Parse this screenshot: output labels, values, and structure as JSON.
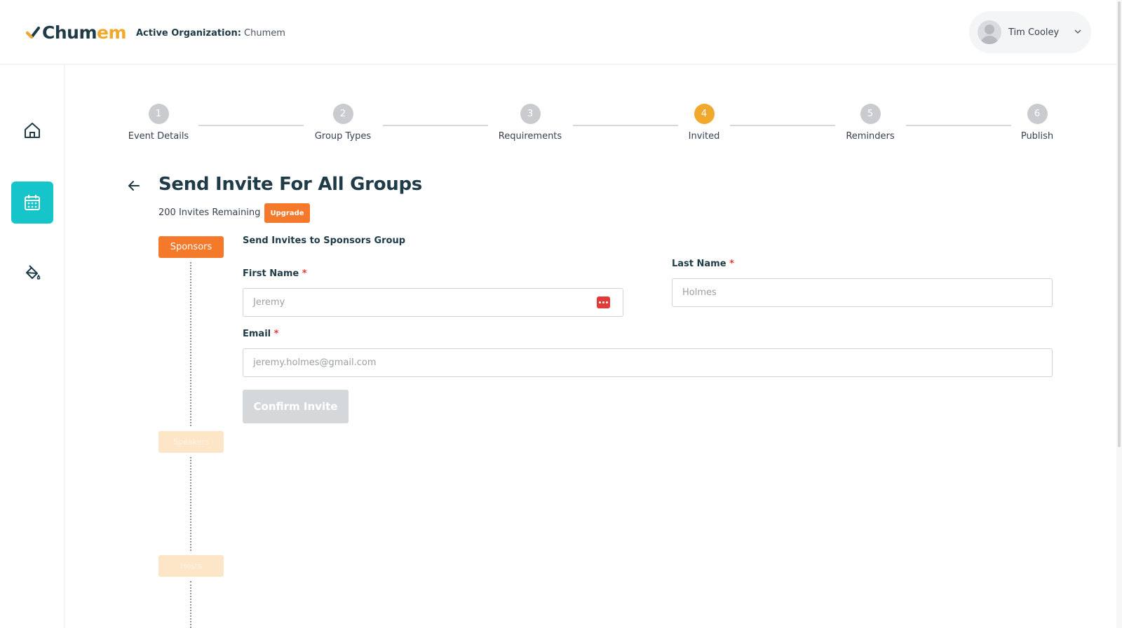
{
  "header": {
    "logo_chum": "Chum",
    "logo_em": "em",
    "active_org_label": "Active Organization:",
    "active_org_value": "Chumem",
    "user_name": "Tim Cooley"
  },
  "sidebar": {
    "items": [
      {
        "icon": "home-icon",
        "active": false
      },
      {
        "icon": "calendar-icon",
        "active": true
      },
      {
        "icon": "paint-bucket-icon",
        "active": false
      }
    ]
  },
  "stepper": {
    "current_step": 4,
    "steps": [
      {
        "number": "1",
        "label": "Event Details"
      },
      {
        "number": "2",
        "label": "Group Types"
      },
      {
        "number": "3",
        "label": "Requirements"
      },
      {
        "number": "4",
        "label": "Invited"
      },
      {
        "number": "5",
        "label": "Reminders"
      },
      {
        "number": "6",
        "label": "Publish"
      }
    ]
  },
  "page": {
    "title": "Send Invite For All Groups",
    "invites_remaining": "200 Invites Remaining",
    "upgrade_label": "Upgrade"
  },
  "groups": {
    "active_label": "Sponsors",
    "faded_1": "Speakers",
    "faded_2": "Hosts"
  },
  "form": {
    "heading": "Send Invites to Sponsors Group",
    "first_name_label": "First Name",
    "first_name_placeholder": "Jeremy",
    "last_name_label": "Last Name",
    "last_name_placeholder": "Holmes",
    "email_label": "Email",
    "email_placeholder": "jeremy.holmes@gmail.com",
    "required_mark": "*",
    "confirm_label": "Confirm Invite"
  },
  "colors": {
    "accent_teal": "#16c5c9",
    "accent_orange": "#f5792a",
    "step_active": "#f0a92c",
    "brand_dark": "#1f3b47"
  }
}
